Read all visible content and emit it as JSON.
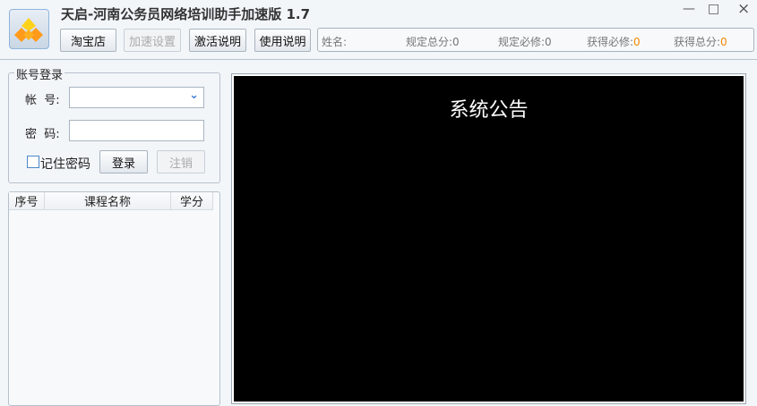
{
  "window": {
    "title": "天启-河南公务员网络培训助手加速版 1.7",
    "minimize": "—",
    "maximize": "□",
    "close": "×"
  },
  "toolbar": {
    "taobao": "淘宝店",
    "speed_settings": "加速设置",
    "activation_help": "激活说明",
    "usage_help": "使用说明"
  },
  "info": {
    "name_label": "姓名:",
    "required_total": "规定总分:0",
    "required_compulsory": "规定必修:0",
    "earned_compulsory_label": "获得必修:",
    "earned_compulsory_value": "0",
    "earned_total_label": "获得总分:",
    "earned_total_value": "0"
  },
  "login": {
    "group_title": "账号登录",
    "account_label": "帐  号:",
    "account_value": "",
    "dropdown_icon": "⌄",
    "password_label": "密  码:",
    "password_value": "",
    "remember": "记住密码",
    "login_button": "登录",
    "logout_button": "注销"
  },
  "courses": {
    "columns": [
      "序号",
      "课程名称",
      "学分"
    ],
    "rows": []
  },
  "notice": {
    "title": "系统公告"
  }
}
